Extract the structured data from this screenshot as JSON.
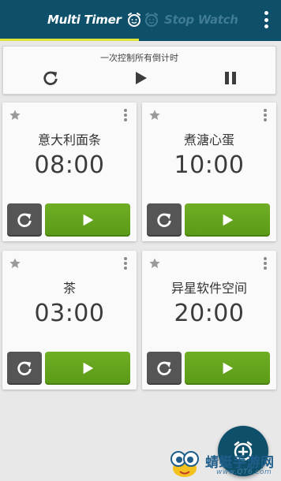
{
  "header": {
    "tabs": [
      {
        "label": "Multi Timer",
        "icon": "alarm-clock-icon",
        "active": true
      },
      {
        "label": "Stop Watch",
        "icon": "alarm-clock-icon",
        "active": false
      }
    ],
    "menu_icon": "overflow-menu-icon"
  },
  "control_panel": {
    "caption": "一次控制所有倒计时",
    "buttons": [
      "reset-all-icon",
      "play-all-icon",
      "pause-all-icon"
    ]
  },
  "timers": [
    {
      "name": "意大利面条",
      "time": "08:00"
    },
    {
      "name": "煮溏心蛋",
      "time": "10:00"
    },
    {
      "name": "茶",
      "time": "03:00"
    },
    {
      "name": "异星软件空间",
      "time": "20:00"
    }
  ],
  "fab": {
    "icon": "add-timer-icon"
  },
  "watermark": {
    "text": "蜻蜓手游网",
    "url": "www.QT6.com"
  },
  "colors": {
    "header": "#0e4f69",
    "tab_underline": "#dfe33a",
    "play_green": "#5f9f1a",
    "reset_gray": "#555555",
    "inactive_tab": "#3f7b93"
  }
}
